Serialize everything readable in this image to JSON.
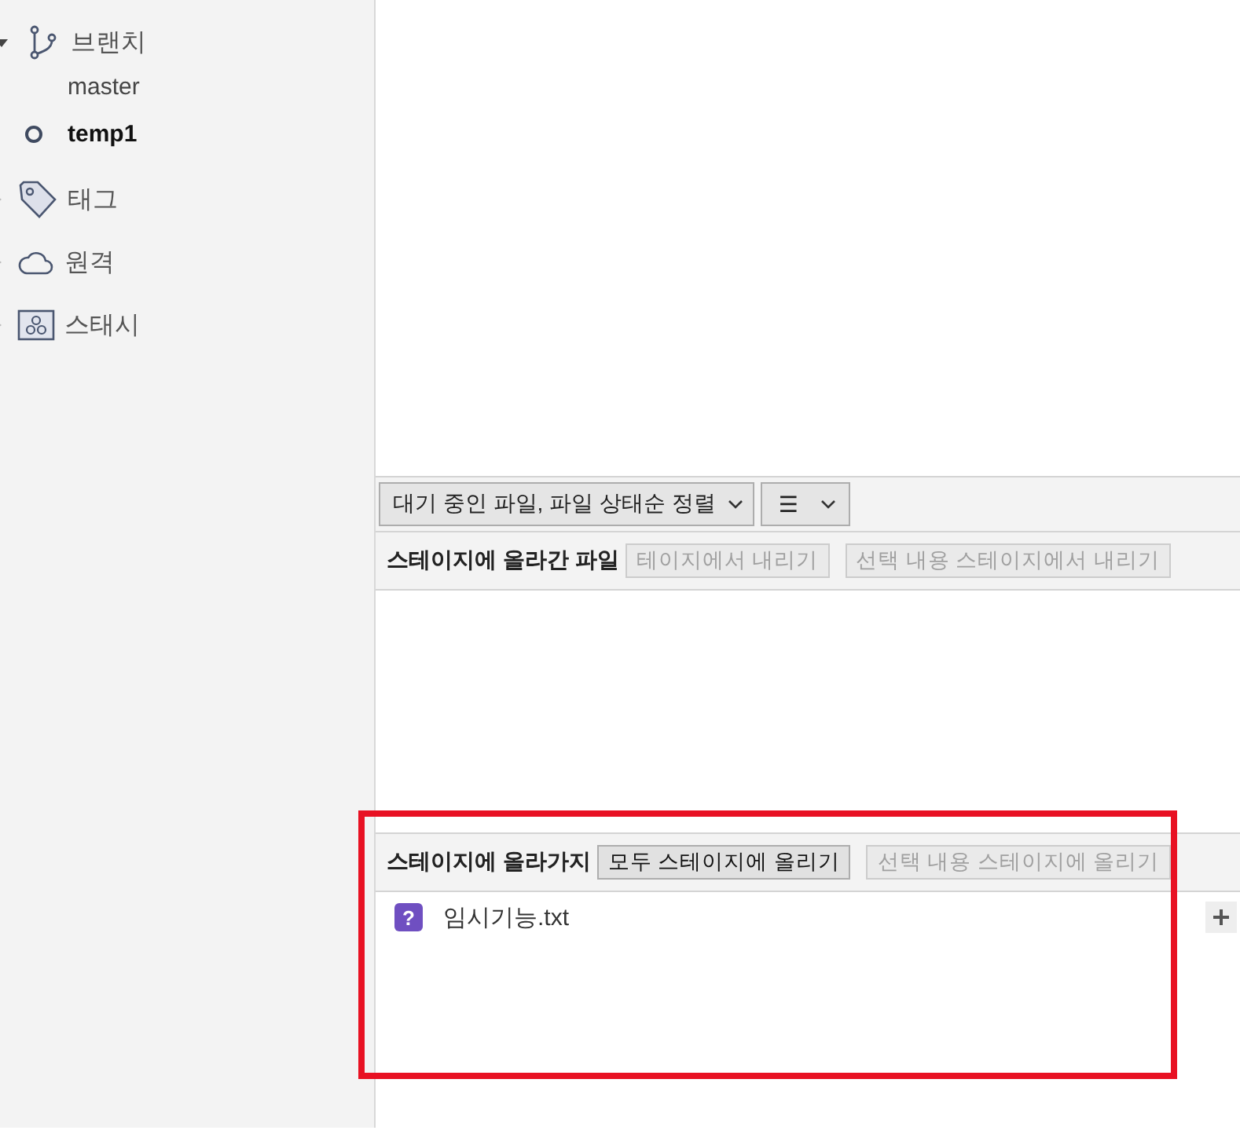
{
  "sidebar": {
    "sections": [
      {
        "kind": "branch",
        "label": "브랜치",
        "expanded": true,
        "children": [
          {
            "label": "master",
            "current": false
          },
          {
            "label": "temp1",
            "current": true
          }
        ]
      },
      {
        "kind": "tag",
        "label": "태그",
        "expanded": false
      },
      {
        "kind": "remote",
        "label": "원격",
        "expanded": false
      },
      {
        "kind": "stash",
        "label": "스태시",
        "expanded": false
      }
    ]
  },
  "toolbar": {
    "sort_dropdown": "대기 중인 파일, 파일 상태순 정렬",
    "view_icon": "☰"
  },
  "staged": {
    "title": "스테이지에 올라간 파일",
    "buttons": [
      {
        "label": "테이지에서 내리기",
        "disabled": true
      },
      {
        "label": "선택 내용 스테이지에서 내리기",
        "disabled": true
      }
    ]
  },
  "unstaged": {
    "title": "스테이지에 올라가지",
    "buttons": [
      {
        "label": "모두 스테이지에 올리기",
        "disabled": false
      },
      {
        "label": "선택 내용 스테이지에 올리기",
        "disabled": true
      }
    ],
    "files": [
      {
        "name": "임시기능.txt",
        "status_icon": "?"
      }
    ]
  },
  "highlight": {
    "color": "#e81123"
  }
}
